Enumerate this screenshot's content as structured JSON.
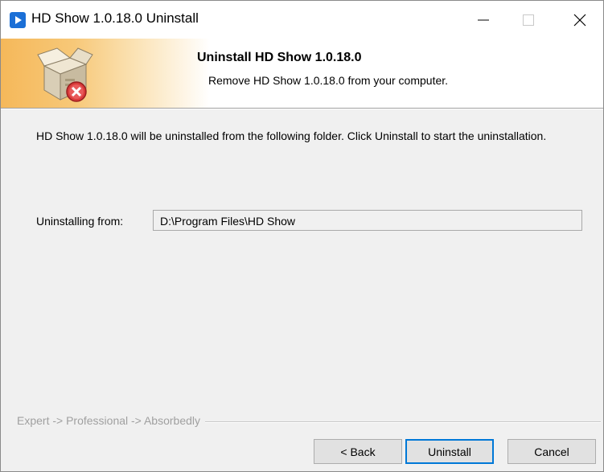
{
  "window": {
    "title": "HD Show 1.0.18.0 Uninstall",
    "minimize_label": "—",
    "close_label": "✕"
  },
  "header": {
    "title": "Uninstall HD Show 1.0.18.0",
    "subtitle": "Remove HD Show 1.0.18.0 from your computer."
  },
  "body": {
    "intro": "HD Show 1.0.18.0 will be uninstalled from the following folder. Click Uninstall to start the uninstallation.",
    "from_label": "Uninstalling from:",
    "from_value": "D:\\Program Files\\HD Show"
  },
  "footer": {
    "brand": "Expert -> Professional -> Absorbedly",
    "back_label": "< Back",
    "uninstall_label": "Uninstall",
    "cancel_label": "Cancel"
  },
  "colors": {
    "accent": "#0078d7",
    "app_icon": "#1b6fd6",
    "banner_orange": "#f5b85a"
  },
  "icons": {
    "app": "play-icon",
    "header": "uninstall-box-icon"
  }
}
